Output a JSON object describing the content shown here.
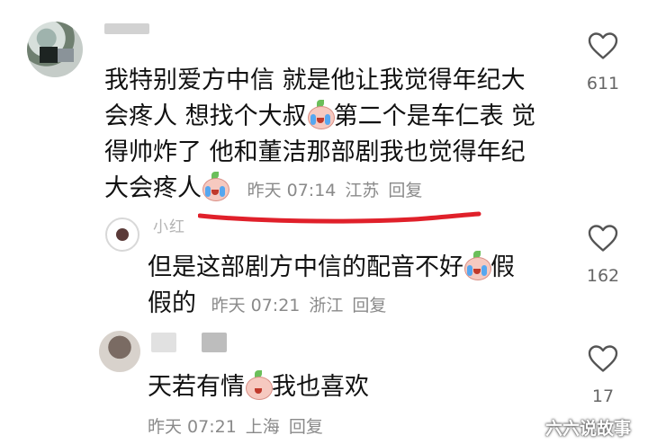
{
  "comments": [
    {
      "text_1": "我特别爱方中信 就是他让我觉得年纪大",
      "text_2": "会疼人 想找个大叔",
      "text_2b": "第二个是车仁表 觉",
      "text_3": "得帅炸了 他和董洁那部剧我也觉得年纪",
      "text_4": "大会疼人",
      "time": "昨天 07:14",
      "location": "江苏",
      "reply": "回复",
      "likes": "611"
    },
    {
      "username": "小红",
      "text_1": "但是这部剧方中信的配音不好",
      "text_1b": "假",
      "text_2": "假的",
      "time": "昨天 07:21",
      "location": "浙江",
      "reply": "回复",
      "likes": "162"
    },
    {
      "text_1": "天若有情",
      "text_1b": "我也喜欢",
      "time": "昨天 07:21",
      "location": "上海",
      "reply": "回复",
      "likes": "17"
    }
  ],
  "watermark": "六六说故事",
  "icons": {
    "like": "heart-outline-icon",
    "emoji": "crying-peach-emoji-icon"
  },
  "colors": {
    "annotation_line": "#e0202a",
    "meta_text": "#8a8a8a"
  }
}
